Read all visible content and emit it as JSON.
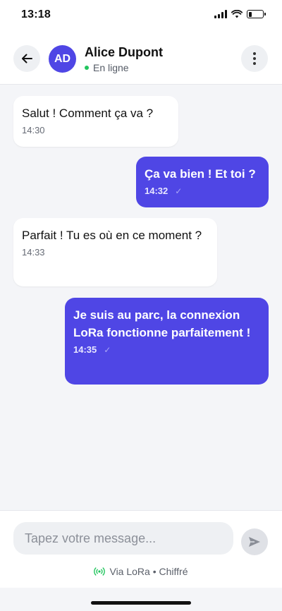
{
  "status_bar": {
    "time": "13:18",
    "battery_level": 0.25
  },
  "header": {
    "back_icon": "arrow-left-icon",
    "avatar_initials": "AD",
    "contact_name": "Alice Dupont",
    "presence": "En ligne",
    "more_icon": "more-vertical-icon"
  },
  "messages": [
    {
      "direction": "incoming",
      "text": "Salut ! Comment ça va ?",
      "time": "14:30"
    },
    {
      "direction": "outgoing",
      "text": "Ça va bien ! Et toi ?",
      "time": "14:32",
      "status_icon": "check-icon"
    },
    {
      "direction": "incoming",
      "text": "Parfait ! Tu es où en ce moment ?",
      "time": "14:33"
    },
    {
      "direction": "outgoing",
      "text": "Je suis au parc, la connexion LoRa fonctionne parfaitement !",
      "time": "14:35",
      "status_icon": "check-icon"
    }
  ],
  "composer": {
    "placeholder": "Tapez votre message...",
    "value": "",
    "send_icon": "send-icon",
    "transport_icon": "radio-signal-icon",
    "transport_text": "Via LoRa • Chiffré"
  },
  "colors": {
    "accent": "#4f46e5",
    "online": "#22c55e",
    "lora": "#22c55e"
  }
}
